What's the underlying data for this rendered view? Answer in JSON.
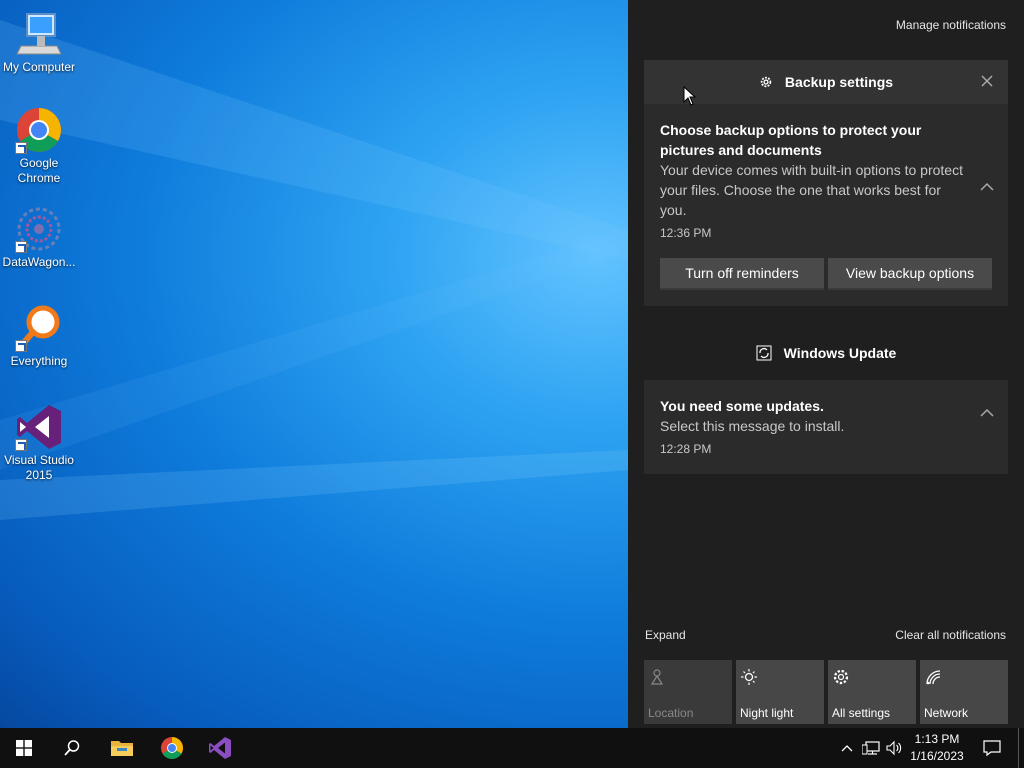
{
  "desktop": {
    "icons": [
      {
        "label": "My Computer",
        "icon": "computer-icon"
      },
      {
        "label": "Google Chrome",
        "icon": "chrome-icon"
      },
      {
        "label": "DataWagon...",
        "icon": "datawagon-icon"
      },
      {
        "label": "Everything",
        "icon": "search-magnifier-icon"
      },
      {
        "label": "Visual Studio 2015",
        "icon": "visual-studio-icon"
      }
    ]
  },
  "action_center": {
    "manage_notifications": "Manage notifications",
    "backup_group": {
      "header": "Backup settings",
      "notification": {
        "title": "Choose backup options to protect your pictures and documents",
        "body": "Your device comes with built-in options to protect your files. Choose the one that works best for you.",
        "time": "12:36 PM"
      },
      "buttons": [
        "Turn off reminders",
        "View backup options"
      ]
    },
    "update_group": {
      "header": "Windows Update",
      "notification": {
        "title": "You need some updates.",
        "body": "Select this message to install.",
        "time": "12:28 PM"
      }
    },
    "expand": "Expand",
    "clear_all": "Clear all notifications",
    "quick_actions": [
      {
        "label": "Location",
        "icon": "location-icon",
        "enabled": false
      },
      {
        "label": "Night light",
        "icon": "night-light-icon",
        "enabled": true
      },
      {
        "label": "All settings",
        "icon": "gear-icon",
        "enabled": true
      },
      {
        "label": "Network",
        "icon": "network-icon",
        "enabled": true
      }
    ]
  },
  "taskbar": {
    "clock_time": "1:13 PM",
    "clock_date": "1/16/2023",
    "pinned": [
      "start-icon",
      "search-icon",
      "file-explorer-icon",
      "chrome-icon",
      "visual-studio-icon"
    ]
  },
  "colors": {
    "action_center_bg": "#1f1f1f",
    "card_bg": "#2b2b2b",
    "taskbar_bg": "#101010",
    "desktop_accent": "#0e7bdb"
  }
}
